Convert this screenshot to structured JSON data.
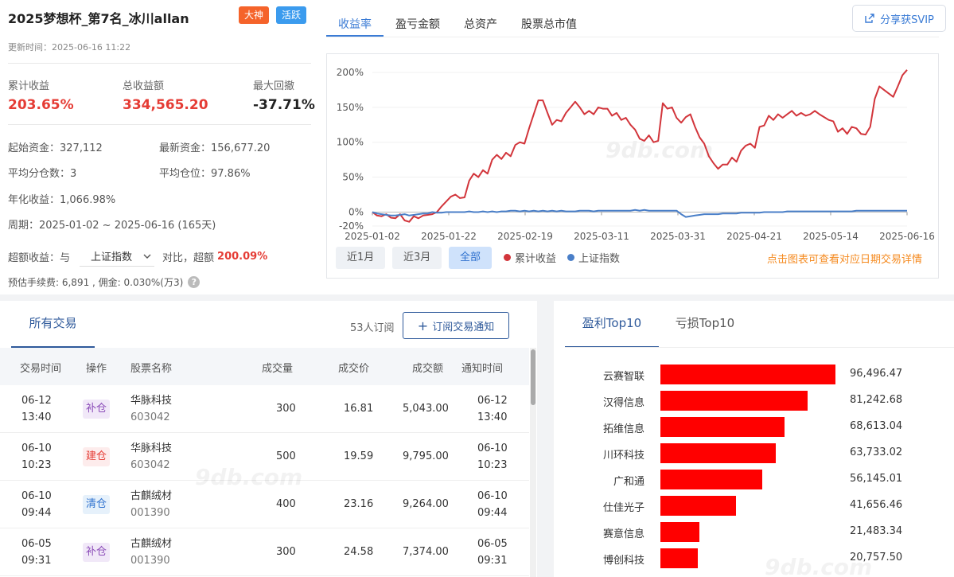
{
  "header": {
    "title": "2025梦想杯_第7名_冰川allan",
    "tags": [
      "大神",
      "活跃"
    ],
    "update_time": "更新时间：2025-06-16 11:22",
    "share_label": "分享获SVIP"
  },
  "kpis": [
    {
      "label": "累计收益",
      "value": "203.65%"
    },
    {
      "label": "总收益额",
      "value": "334,565.20"
    },
    {
      "label": "最大回撤",
      "value": "-37.71%"
    }
  ],
  "info": {
    "start_capital": "起始资金：327,112",
    "latest_capital": "最新资金：156,677.20",
    "avg_split": "平均分仓数：3",
    "avg_position": "平均仓位：97.86%",
    "annual": "年化收益：1,066.98%",
    "period": "周期：2025-01-02 ~ 2025-06-16 (165天)",
    "excess_prefix": "超额收益：与",
    "excess_select": "上证指数",
    "excess_mid": "对比，超额",
    "excess_value": "200.09%",
    "fee": "预估手续费: 6,891 , 佣金: 0.030%(万3)"
  },
  "tabs": [
    "收益率",
    "盈亏金额",
    "总资产",
    "股票总市值"
  ],
  "range_buttons": [
    "近1月",
    "近3月",
    "全部"
  ],
  "legend": [
    {
      "name": "累计收益",
      "color": "#d2353b"
    },
    {
      "name": "上证指数",
      "color": "#4a7fc8"
    }
  ],
  "chart_hint": "点击图表可查看对应日期交易详情",
  "watermark": "9db.com",
  "chart_data": {
    "type": "line",
    "y_ticks": [
      "200%",
      "150%",
      "100%",
      "50%",
      "0%",
      "-20%"
    ],
    "ylim": [
      -20,
      200
    ],
    "x_ticks": [
      "2025-01-02",
      "2025-01-22",
      "2025-02-19",
      "2025-03-11",
      "2025-03-31",
      "2025-04-21",
      "2025-05-14",
      "2025-06-16"
    ],
    "series": [
      {
        "name": "累计收益",
        "color": "#d2353b",
        "values": [
          0,
          -5,
          -6,
          -3,
          -8,
          -9,
          -3,
          -12,
          -14,
          -6,
          -9,
          -5,
          -4,
          -3,
          0,
          8,
          15,
          22,
          25,
          20,
          21,
          45,
          55,
          50,
          60,
          55,
          75,
          82,
          76,
          85,
          80,
          96,
          100,
          98,
          120,
          140,
          160,
          160,
          142,
          125,
          132,
          130,
          142,
          150,
          158,
          150,
          140,
          145,
          140,
          150,
          148,
          148,
          138,
          142,
          132,
          135,
          125,
          118,
          105,
          102,
          110,
          100,
          102,
          156,
          148,
          150,
          135,
          128,
          136,
          140,
          122,
          107,
          98,
          80,
          70,
          62,
          68,
          68,
          78,
          72,
          88,
          95,
          98,
          92,
          122,
          124,
          138,
          132,
          140,
          135,
          140,
          145,
          138,
          142,
          138,
          140,
          145,
          140,
          136,
          132,
          130,
          115,
          120,
          112,
          122,
          120,
          112,
          111,
          122,
          162,
          180,
          175,
          170,
          165,
          180,
          196,
          203.65
        ]
      },
      {
        "name": "上证指数",
        "color": "#4a7fc8",
        "values": [
          0,
          -2,
          -3,
          -4,
          -5,
          -5,
          -4,
          -3,
          -5,
          -4,
          -3,
          -2,
          -2,
          0,
          -1,
          -1,
          0,
          0,
          0,
          0,
          0,
          1,
          0,
          0,
          1,
          0,
          1,
          0,
          1,
          1,
          2,
          2,
          1,
          2,
          1,
          2,
          1,
          2,
          1,
          2,
          1,
          2,
          1,
          1,
          1,
          2,
          2,
          2,
          1,
          2,
          2,
          2,
          2,
          2,
          2,
          2,
          2,
          3,
          2,
          3,
          2,
          2,
          2,
          2,
          2,
          2,
          2,
          -3,
          -7,
          -6,
          -5,
          -4,
          -3,
          -3,
          -3,
          -3,
          -2,
          -2,
          -2,
          -2,
          -1,
          -1,
          -1,
          -1,
          -1,
          0,
          0,
          0,
          0,
          0,
          1,
          1,
          1,
          1,
          1,
          1,
          1,
          1,
          1,
          1,
          1,
          1,
          1,
          1,
          1,
          2,
          2,
          2,
          2,
          2,
          2,
          2,
          2,
          2,
          2,
          2,
          2
        ]
      }
    ]
  },
  "trades": {
    "tab_label": "所有交易",
    "sub_count": "53人订阅",
    "sub_button": "订阅交易通知",
    "columns": [
      "交易时间",
      "操作",
      "股票名称",
      "成交量",
      "成交价",
      "成交额",
      "通知时间"
    ],
    "rows": [
      {
        "date": "06-12",
        "time": "13:40",
        "op": "补仓",
        "name": "华脉科技",
        "code": "603042",
        "qty": "300",
        "price": "16.81",
        "amount": "5,043.00",
        "ndate": "06-12",
        "ntime": "13:40"
      },
      {
        "date": "06-10",
        "time": "10:23",
        "op": "建仓",
        "name": "华脉科技",
        "code": "603042",
        "qty": "500",
        "price": "19.59",
        "amount": "9,795.00",
        "ndate": "06-10",
        "ntime": "10:23"
      },
      {
        "date": "06-10",
        "time": "09:44",
        "op": "清仓",
        "name": "古麒绒材",
        "code": "001390",
        "qty": "400",
        "price": "23.16",
        "amount": "9,264.00",
        "ndate": "06-10",
        "ntime": "09:44"
      },
      {
        "date": "06-05",
        "time": "09:31",
        "op": "补仓",
        "name": "古麒绒材",
        "code": "001390",
        "qty": "300",
        "price": "24.58",
        "amount": "7,374.00",
        "ndate": "06-05",
        "ntime": "09:31"
      }
    ]
  },
  "top10": {
    "tabs": [
      "盈利Top10",
      "亏损Top10"
    ],
    "items": [
      {
        "name": "云赛智联",
        "value": 96496.47,
        "label": "96,496.47"
      },
      {
        "name": "汉得信息",
        "value": 81242.68,
        "label": "81,242.68"
      },
      {
        "name": "拓维信息",
        "value": 68613.04,
        "label": "68,613.04"
      },
      {
        "name": "川环科技",
        "value": 63733.02,
        "label": "63,733.02"
      },
      {
        "name": "广和通",
        "value": 56145.01,
        "label": "56,145.01"
      },
      {
        "name": "仕佳光子",
        "value": 41656.46,
        "label": "41,656.46"
      },
      {
        "name": "赛意信息",
        "value": 21483.34,
        "label": "21,483.34"
      },
      {
        "name": "博创科技",
        "value": 20757.5,
        "label": "20,757.50"
      }
    ]
  }
}
